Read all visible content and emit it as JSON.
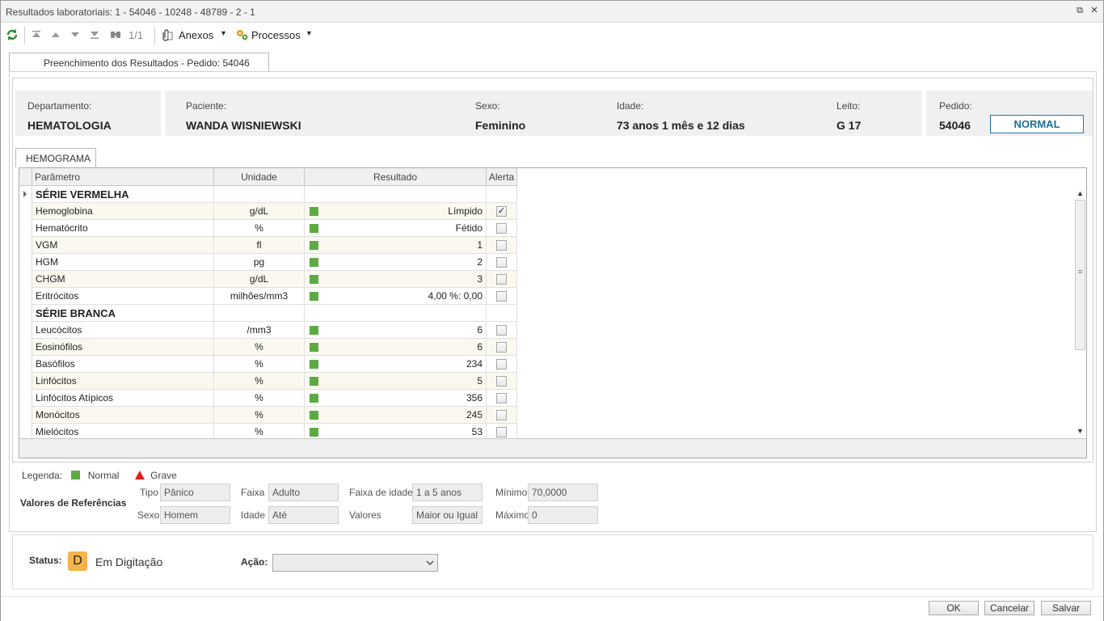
{
  "window": {
    "title": "Resultados laboratoriais: 1 - 54046 - 10248 - 48789 - 2 - 1",
    "restore_glyph": "⧉",
    "close_glyph": "×"
  },
  "toolbar": {
    "counter": "1/1",
    "anexos_label": "Anexos",
    "processos_label": "Processos",
    "icons": [
      "refresh-icon",
      "first-icon",
      "prev-icon",
      "next-icon",
      "last-icon",
      "binoculars-icon",
      "paperclip-icon",
      "gears-icon"
    ]
  },
  "main_tab": "Preenchimento dos Resultados - Pedido: 54046",
  "patient": {
    "departamento_label": "Departamento:",
    "departamento": "HEMATOLOGIA",
    "paciente_label": "Paciente:",
    "paciente": "WANDA WISNIEWSKI",
    "sexo_label": "Sexo:",
    "sexo": "Feminino",
    "idade_label": "Idade:",
    "idade": "73 anos 1 mês  e 12 dias",
    "leito_label": "Leito:",
    "leito": "G 17",
    "pedido_label": "Pedido:",
    "pedido": "54046",
    "priority": "NORMAL"
  },
  "sub_tab": "HEMOGRAMA",
  "grid": {
    "headers": {
      "parametro": "Parâmetro",
      "unidade": "Unidade",
      "resultado": "Resultado",
      "alerta": "Alerta"
    },
    "normal_color": "#5daa45",
    "rows": [
      {
        "group": true,
        "parametro": "SÉRIE VERMELHA"
      },
      {
        "parametro": "Hemoglobina",
        "unidade": "g/dL",
        "resultado": "Límpido",
        "alerta": true
      },
      {
        "parametro": "Hematócrito",
        "unidade": "%",
        "resultado": "Fétido",
        "alerta": false
      },
      {
        "parametro": "VGM",
        "unidade": "fl",
        "resultado": "1",
        "alerta": false
      },
      {
        "parametro": "HGM",
        "unidade": "pg",
        "resultado": "2",
        "alerta": false
      },
      {
        "parametro": "CHGM",
        "unidade": "g/dL",
        "resultado": "3",
        "alerta": false
      },
      {
        "parametro": "Eritrócitos",
        "unidade": "milhões/mm3",
        "resultado": "4,00 %: 0,00",
        "alerta": false
      },
      {
        "group": true,
        "parametro": "SÉRIE BRANCA"
      },
      {
        "parametro": "Leucócitos",
        "unidade": "/mm3",
        "resultado": "6",
        "alerta": false
      },
      {
        "parametro": "Eosinófilos",
        "unidade": "%",
        "resultado": "6",
        "alerta": false
      },
      {
        "parametro": "Basófilos",
        "unidade": "%",
        "resultado": "234",
        "alerta": false
      },
      {
        "parametro": "Linfócitos",
        "unidade": "%",
        "resultado": "5",
        "alerta": false
      },
      {
        "parametro": "Linfócitos Atípicos",
        "unidade": "%",
        "resultado": "356",
        "alerta": false
      },
      {
        "parametro": "Monócitos",
        "unidade": "%",
        "resultado": "245",
        "alerta": false
      },
      {
        "parametro": "Mielócitos",
        "unidade": "%",
        "resultado": "53",
        "alerta": false
      }
    ]
  },
  "legend": {
    "label": "Legenda:",
    "normal": "Normal",
    "grave": "Grave",
    "grave_color": "#e02020"
  },
  "references": {
    "title": "Valores de Referências",
    "tipo_label": "Tipo",
    "tipo": "Pânico",
    "faixa_label": "Faixa",
    "faixa": "Adulto",
    "faixa_idade_label": "Faixa de idade",
    "faixa_idade": "1 a 5 anos",
    "minimo_label": "Mínimo",
    "minimo": "70,0000",
    "sexo_label": "Sexo",
    "sexo": "Homem",
    "idade_label": "Idade",
    "idade": "Até",
    "valores_label": "Valores",
    "valores": "Maior ou Igual",
    "maximo_label": "Máximo",
    "maximo": "0"
  },
  "status": {
    "label": "Status:",
    "badge": "D",
    "text": "Em Digitação",
    "badge_color": "#f5b34a",
    "acao_label": "Ação:",
    "acao_value": ""
  },
  "buttons": {
    "ok": "OK",
    "cancel": "Cancelar",
    "save": "Salvar"
  }
}
